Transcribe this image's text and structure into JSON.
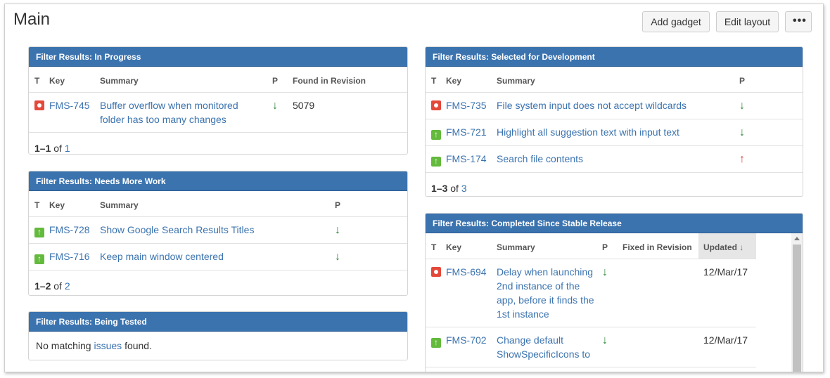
{
  "page": {
    "title": "Main",
    "buttons": {
      "add_gadget": "Add gadget",
      "edit_layout": "Edit layout",
      "more": "•••"
    }
  },
  "columns": {
    "t": "T",
    "key": "Key",
    "summary": "Summary",
    "p": "P",
    "found_in_revision": "Found in Revision",
    "fixed_in_revision": "Fixed in Revision",
    "updated": "Updated"
  },
  "gadgets": {
    "in_progress": {
      "title": "Filter Results: In Progress",
      "rows": [
        {
          "type": "bug",
          "key": "FMS-745",
          "summary": "Buffer overflow when monitored folder has too many changes",
          "priority": "low",
          "found_in_revision": "5079"
        }
      ],
      "footer": {
        "range": "1–1",
        "of": "of",
        "total": "1"
      }
    },
    "needs_more_work": {
      "title": "Filter Results: Needs More Work",
      "rows": [
        {
          "type": "improvement",
          "key": "FMS-728",
          "summary": "Show Google Search Results Titles",
          "priority": "low"
        },
        {
          "type": "improvement",
          "key": "FMS-716",
          "summary": "Keep main window centered",
          "priority": "low"
        }
      ],
      "footer": {
        "range": "1–2",
        "of": "of",
        "total": "2"
      }
    },
    "being_tested": {
      "title": "Filter Results: Being Tested",
      "message_prefix": "No matching",
      "message_link": "issues",
      "message_suffix": "found."
    },
    "selected_for_development": {
      "title": "Filter Results: Selected for Development",
      "rows": [
        {
          "type": "bug",
          "key": "FMS-735",
          "summary": "File system input does not accept wildcards",
          "priority": "low"
        },
        {
          "type": "improvement",
          "key": "FMS-721",
          "summary": "Highlight all suggestion text with input text",
          "priority": "low"
        },
        {
          "type": "improvement",
          "key": "FMS-174",
          "summary": "Search file contents",
          "priority": "high"
        }
      ],
      "footer": {
        "range": "1–3",
        "of": "of",
        "total": "3"
      }
    },
    "completed_since_stable": {
      "title": "Filter Results: Completed Since Stable Release",
      "rows": [
        {
          "type": "bug",
          "key": "FMS-694",
          "summary": "Delay when launching 2nd instance of the app, before it finds the 1st instance",
          "priority": "low",
          "fixed_in_revision": "",
          "updated": "12/Mar/17"
        },
        {
          "type": "improvement",
          "key": "FMS-702",
          "summary": "Change default ShowSpecificIcons to",
          "priority": "low",
          "fixed_in_revision": "",
          "updated": "12/Mar/17"
        }
      ]
    }
  },
  "icons": {
    "bug": "bug-icon",
    "improvement": "improvement-icon",
    "low": "priority-low-icon",
    "high": "priority-high-icon"
  },
  "colors": {
    "header": "#3b73af",
    "link": "#3b73af",
    "bug": "#e5493a",
    "improvement": "#63ba3c",
    "priority_low": "#2a8735",
    "priority_high": "#d04437"
  }
}
